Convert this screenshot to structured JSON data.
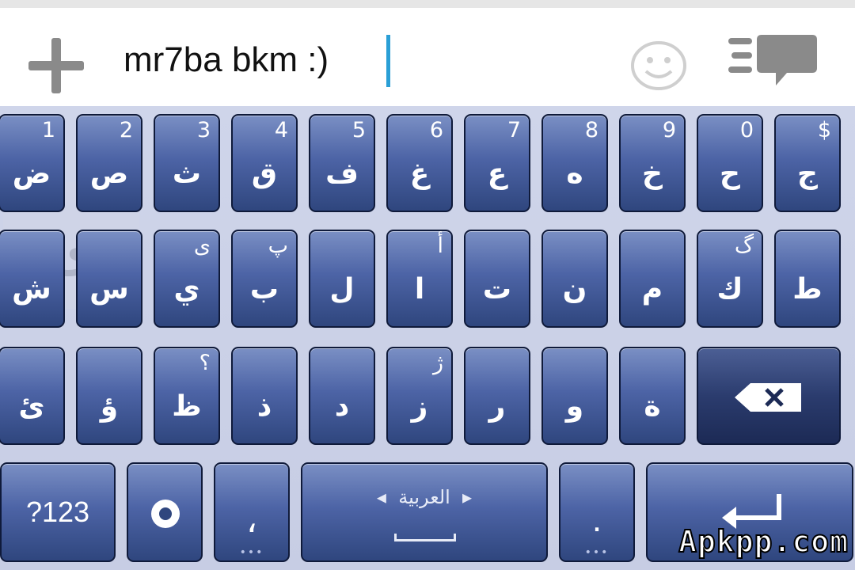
{
  "input": {
    "text": "mr7ba bkm :)"
  },
  "icons": [
    "plus-icon",
    "smiley-icon",
    "chat-list-icon",
    "backspace-icon",
    "settings-icon",
    "enter-icon"
  ],
  "row1": [
    {
      "main": "ض",
      "hint": "1"
    },
    {
      "main": "ص",
      "hint": "2"
    },
    {
      "main": "ث",
      "hint": "3"
    },
    {
      "main": "ق",
      "hint": "4"
    },
    {
      "main": "ف",
      "hint": "5"
    },
    {
      "main": "غ",
      "hint": "6"
    },
    {
      "main": "ع",
      "hint": "7"
    },
    {
      "main": "ه",
      "hint": "8"
    },
    {
      "main": "خ",
      "hint": "9"
    },
    {
      "main": "ح",
      "hint": "0"
    },
    {
      "main": "ج",
      "hint": "$"
    }
  ],
  "row2": [
    {
      "main": "ش",
      "hint": ""
    },
    {
      "main": "س",
      "hint": ""
    },
    {
      "main": "ي",
      "hint": "ى"
    },
    {
      "main": "ب",
      "hint": "پ"
    },
    {
      "main": "ل",
      "hint": ""
    },
    {
      "main": "ا",
      "hint": "أ"
    },
    {
      "main": "ت",
      "hint": ""
    },
    {
      "main": "ن",
      "hint": ""
    },
    {
      "main": "م",
      "hint": ""
    },
    {
      "main": "ك",
      "hint": "گ"
    },
    {
      "main": "ط",
      "hint": ""
    }
  ],
  "row3": [
    {
      "main": "ئ",
      "hint": ""
    },
    {
      "main": "ؤ",
      "hint": ""
    },
    {
      "main": "ظ",
      "hint": "؟"
    },
    {
      "main": "ذ",
      "hint": ""
    },
    {
      "main": "د",
      "hint": ""
    },
    {
      "main": "ز",
      "hint": "ژ"
    },
    {
      "main": "ر",
      "hint": ""
    },
    {
      "main": "و",
      "hint": ""
    },
    {
      "main": "ة",
      "hint": ""
    }
  ],
  "popup_letter": "ى",
  "bottom": {
    "numbers_label": "?123",
    "comma": "،",
    "language_label": "العربية",
    "period": "."
  },
  "watermark": "Apkpp.com",
  "colors": {
    "key_top": "#7a8fc4",
    "key_bottom": "#2f467e",
    "cursor": "#2a9fd6"
  }
}
